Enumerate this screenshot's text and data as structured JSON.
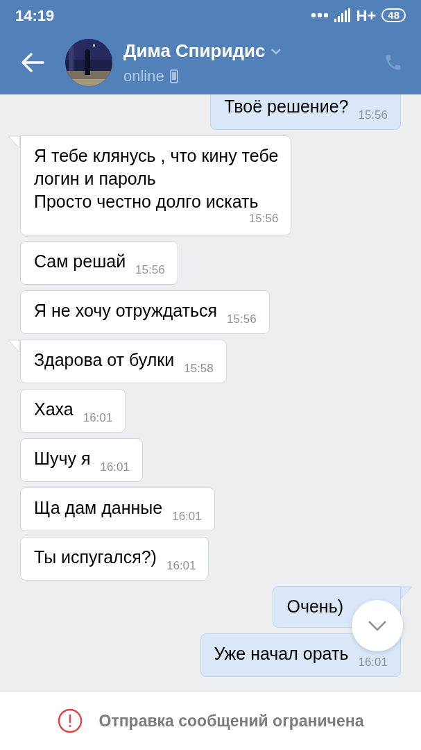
{
  "status_bar": {
    "time": "14:19",
    "network": "H+",
    "battery": "48"
  },
  "header": {
    "name": "Дима Спиридис",
    "presence": "online"
  },
  "messages": [
    {
      "kind": "out",
      "text": "Твоё решение?",
      "time": "15:56",
      "tail": false
    },
    {
      "kind": "in",
      "text": "Я тебе клянусь , что кину тебе\nлогин и пароль\nПросто честно долго искать",
      "time": "15:56",
      "tail": true
    },
    {
      "kind": "in",
      "text": "Сам решай",
      "time": "15:56",
      "tail": false
    },
    {
      "kind": "in",
      "text": "Я не хочу отруждаться",
      "time": "15:56",
      "tail": false
    },
    {
      "kind": "in",
      "text": "Здарова от булки",
      "time": "15:58",
      "tail": true
    },
    {
      "kind": "in",
      "text": "Хаха",
      "time": "16:01",
      "tail": false
    },
    {
      "kind": "in",
      "text": "Шучу я",
      "time": "16:01",
      "tail": false
    },
    {
      "kind": "in",
      "text": "Ща дам данные",
      "time": "16:01",
      "tail": false
    },
    {
      "kind": "in",
      "text": "Ты испугался?)",
      "time": "16:01",
      "tail": false
    },
    {
      "kind": "out",
      "text": "Очень)",
      "tail": true
    },
    {
      "kind": "out",
      "text": "Уже начал орать",
      "time": "16:01",
      "tail": false
    }
  ],
  "notice": "Отправка сообщений ограничена"
}
